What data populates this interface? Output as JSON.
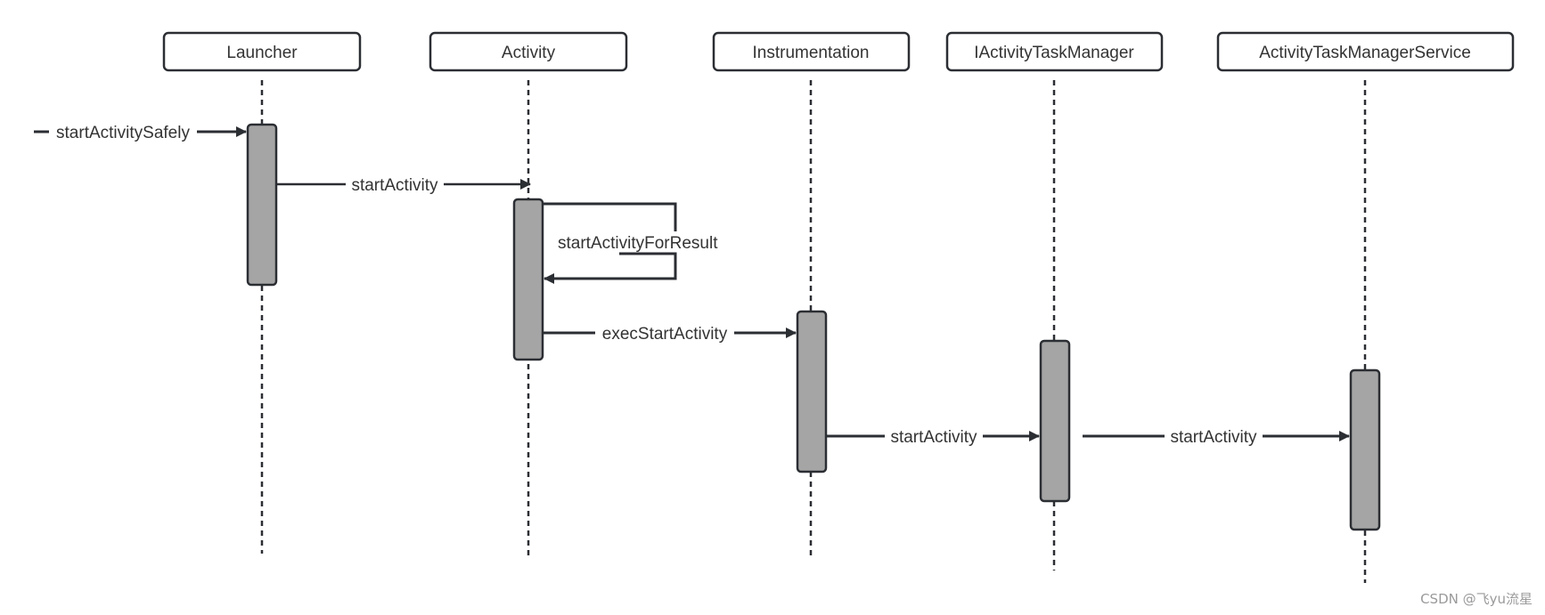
{
  "diagram": {
    "type": "sequence",
    "participants": [
      {
        "id": "launcher",
        "label": "Launcher"
      },
      {
        "id": "activity",
        "label": "Activity"
      },
      {
        "id": "instrumentation",
        "label": "Instrumentation"
      },
      {
        "id": "iatm",
        "label": "IActivityTaskManager"
      },
      {
        "id": "atms",
        "label": "ActivityTaskManagerService"
      }
    ],
    "messages": [
      {
        "from": "external",
        "to": "launcher",
        "label": "startActivitySafely"
      },
      {
        "from": "launcher",
        "to": "activity",
        "label": "startActivity"
      },
      {
        "from": "activity",
        "to": "activity",
        "label": "startActivityForResult"
      },
      {
        "from": "activity",
        "to": "instrumentation",
        "label": "execStartActivity"
      },
      {
        "from": "instrumentation",
        "to": "iatm",
        "label": "startActivity"
      },
      {
        "from": "iatm",
        "to": "atms",
        "label": "startActivity"
      }
    ],
    "colors": {
      "stroke": "#2b2e33",
      "activation_fill": "#a5a5a5",
      "background": "#ffffff",
      "text": "#333333"
    }
  },
  "watermark": "CSDN @飞yu流星"
}
